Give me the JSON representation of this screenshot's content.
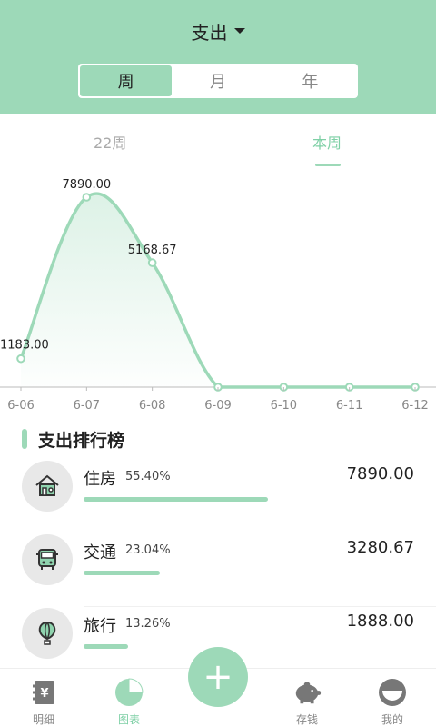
{
  "header": {
    "title": "支出",
    "segments": [
      "周",
      "月",
      "年"
    ],
    "active_segment": "周"
  },
  "week_tabs": {
    "previous": "22周",
    "current": "本周"
  },
  "chart_data": {
    "type": "area",
    "categories": [
      "6-06",
      "6-07",
      "6-08",
      "6-09",
      "6-10",
      "6-11",
      "6-12"
    ],
    "values": [
      1183.0,
      7890.0,
      5168.67,
      0,
      0,
      0,
      0
    ],
    "labels": [
      "1183.00",
      "7890.00",
      "5168.67",
      "",
      "",
      "",
      ""
    ],
    "ylim": [
      0,
      7890
    ],
    "color": "#9dd9b8"
  },
  "ranking": {
    "title": "支出排行榜",
    "items": [
      {
        "name": "住房",
        "percent": "55.40%",
        "amount": "7890.00",
        "fraction": 0.554,
        "icon": "house-icon"
      },
      {
        "name": "交通",
        "percent": "23.04%",
        "amount": "3280.67",
        "fraction": 0.2304,
        "icon": "bus-icon"
      },
      {
        "name": "旅行",
        "percent": "13.26%",
        "amount": "1888.00",
        "fraction": 0.1326,
        "icon": "balloon-icon"
      }
    ]
  },
  "nav": {
    "items": [
      {
        "label": "明细",
        "icon": "ledger-icon"
      },
      {
        "label": "图表",
        "icon": "pie-chart-icon"
      },
      {
        "label": "存钱",
        "icon": "piggy-bank-icon"
      },
      {
        "label": "我的",
        "icon": "profile-icon"
      }
    ],
    "active": "图表",
    "add_label": "+"
  },
  "colors": {
    "accent": "#9dd9b8",
    "accent_text": "#7fd0a6"
  }
}
